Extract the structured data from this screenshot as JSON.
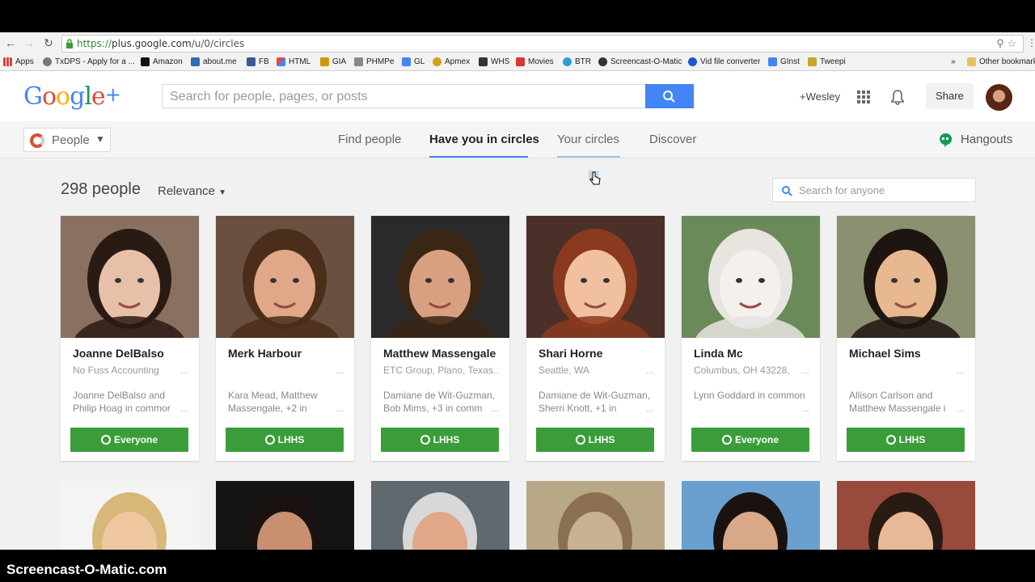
{
  "browser": {
    "url_scheme": "https://",
    "url_host": "plus.google.com",
    "url_path": "/u/0/circles",
    "bookmarks": [
      {
        "label": "Apps",
        "color": "#c44"
      },
      {
        "label": "TxDPS - Apply for a ...",
        "color": "#777"
      },
      {
        "label": "Amazon",
        "color": "#111"
      },
      {
        "label": "about.me",
        "color": "#2a6fb5"
      },
      {
        "label": "FB",
        "color": "#3b5998"
      },
      {
        "label": "HTML",
        "color": "#e44"
      },
      {
        "label": "GIA",
        "color": "#c90"
      },
      {
        "label": "PHMPe",
        "color": "#888"
      },
      {
        "label": "GL",
        "color": "#4285f4"
      },
      {
        "label": "Apmex",
        "color": "#d4a017"
      },
      {
        "label": "WHS",
        "color": "#333"
      },
      {
        "label": "Movies",
        "color": "#d33"
      },
      {
        "label": "BTR",
        "color": "#2a9fd6"
      },
      {
        "label": "Screencast-O-Matic",
        "color": "#333"
      },
      {
        "label": "Vid file converter",
        "color": "#2255cc"
      },
      {
        "label": "GInst",
        "color": "#4285f4"
      },
      {
        "label": "Tweepi",
        "color": "#c9a227"
      }
    ],
    "other_bookmarks": "Other bookmark",
    "overflow": "»"
  },
  "header": {
    "logo": "Google+",
    "search_placeholder": "Search for people, pages, or posts",
    "user": "+Wesley",
    "share": "Share"
  },
  "subnav": {
    "people_label": "People",
    "tabs": [
      {
        "label": "Find people",
        "active": false
      },
      {
        "label": "Have you in circles",
        "active": true
      },
      {
        "label": "Your circles",
        "active": false
      },
      {
        "label": "Discover",
        "active": false
      }
    ],
    "hangouts": "Hangouts"
  },
  "main": {
    "count": "298 people",
    "sort": "Relevance",
    "search_placeholder": "Search for anyone",
    "cards": [
      {
        "name": "Joanne DelBalso",
        "sub": "No Fuss Accounting",
        "mutual_a": "Joanne DelBalso and",
        "mutual_b": "Philip Hoag in commor",
        "circle": "Everyone",
        "skin": "#e6c0a8",
        "hair": "#2a1a14",
        "bg": "#8a7060"
      },
      {
        "name": "Merk Harbour",
        "sub": "",
        "mutual_a": "Kara Mead, Matthew",
        "mutual_b": "Massengale, +2 in",
        "circle": "LHHS",
        "skin": "#e0a888",
        "hair": "#4a2e1a",
        "bg": "#6a5040"
      },
      {
        "name": "Matthew Massengale",
        "sub": "ETC Group, Plano, Texas",
        "mutual_a": "Damiane de Wit-Guzman,",
        "mutual_b": "Bob Mims, +3 in comm",
        "circle": "LHHS",
        "skin": "#d8a080",
        "hair": "#3a2614",
        "bg": "#2a2a2a"
      },
      {
        "name": "Shari Horne",
        "sub": "Seattle, WA",
        "mutual_a": "Damiane de Wit-Guzman,",
        "mutual_b": "Sherri Knott, +1 in",
        "circle": "LHHS",
        "skin": "#f0c0a0",
        "hair": "#8a3a1e",
        "bg": "#4a3028"
      },
      {
        "name": "Linda Mc",
        "sub": "Columbus, OH 43228,",
        "mutual_a": "Lynn Goddard in common",
        "mutual_b": "",
        "circle": "Everyone",
        "skin": "#f4f0ee",
        "hair": "#e8e4e0",
        "bg": "#6a8a5a"
      },
      {
        "name": "Michael Sims",
        "sub": "",
        "mutual_a": "Allison Carlson and",
        "mutual_b": "Matthew Massengale i",
        "circle": "LHHS",
        "skin": "#e8b890",
        "hair": "#1e1410",
        "bg": "#8a9070"
      }
    ],
    "row2_colors": [
      {
        "skin": "#f0c8a0",
        "hair": "#d8b878",
        "bg": "#f4f4f4"
      },
      {
        "skin": "#c89070",
        "hair": "#1a1210",
        "bg": "#141414"
      },
      {
        "skin": "#e0a888",
        "hair": "#d8d8d8",
        "bg": "#606870"
      },
      {
        "skin": "#c8b090",
        "hair": "#8a7050",
        "bg": "#b8a888"
      },
      {
        "skin": "#d8a888",
        "hair": "#1a1210",
        "bg": "#6aa0d0"
      },
      {
        "skin": "#e8b898",
        "hair": "#2a1a14",
        "bg": "#9a4a3a"
      }
    ]
  },
  "watermark": "Screencast-O-Matic.com"
}
